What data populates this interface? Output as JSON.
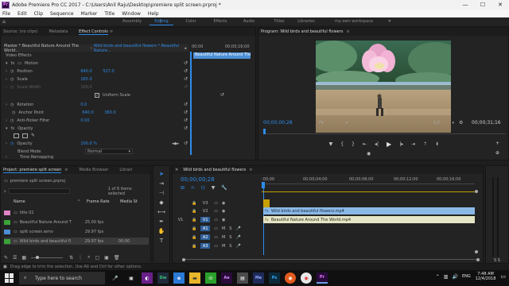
{
  "window": {
    "title": "Adobe Premiere Pro CC 2017 - C:\\Users\\Anil Raju\\Desktop\\premiere split screen.prproj *",
    "app_icon": "Pr",
    "min": "—",
    "max": "☐",
    "close": "✕"
  },
  "menu": [
    "File",
    "Edit",
    "Clip",
    "Sequence",
    "Marker",
    "Title",
    "Window",
    "Help"
  ],
  "workspaces": [
    "Assembly",
    "Editing",
    "Color",
    "Effects",
    "Audio",
    "Titles",
    "Libraries",
    "my own workspace"
  ],
  "workspace_active": "Editing",
  "effect_controls": {
    "tabs": [
      "Source: (no clips)",
      "Metadata",
      "Effect Controls"
    ],
    "active_tab": "Effect Controls",
    "master": "Master * Beautiful Nature Around The World...",
    "clip": "Wild birds and beautiful flowers * Beautiful Nature...",
    "tc_start": "00;00",
    "tc_end": "00;00;16;00",
    "timeline_clip": "Beautiful Nature Around The W",
    "video_effects": "Video Effects",
    "motion": "Motion",
    "position": {
      "label": "Position",
      "x": "640.0",
      "y": "527.0"
    },
    "scale": {
      "label": "Scale",
      "value": "165.0"
    },
    "scale_width": {
      "label": "Scale Width",
      "value": "100.0"
    },
    "uniform": {
      "label": "Uniform Scale",
      "checked": true
    },
    "rotation": {
      "label": "Rotation",
      "value": "0.0"
    },
    "anchor": {
      "label": "Anchor Point",
      "x": "640.0",
      "y": "360.0"
    },
    "antiflicker": {
      "label": "Anti-flicker Filter",
      "value": "0.00"
    },
    "opacity_group": "Opacity",
    "opacity": {
      "label": "Opacity",
      "value": "100.0 %"
    },
    "blend": {
      "label": "Blend Mode",
      "value": "Normal"
    },
    "time_remap": "Time Remapping"
  },
  "program": {
    "title": "Program: Wild birds and beautiful flowers",
    "menu_icon": "≡",
    "timecode": "00;00;00;28",
    "fit": "Fit",
    "fraction": "1/2",
    "duration": "00;00;31;16"
  },
  "project": {
    "tabs": [
      "Project: premiere split screen",
      "Media Browser",
      "Librari"
    ],
    "active_tab": "Project: premiere split screen",
    "file": "premiere split screen.prproj",
    "selected_info": "1 of 6 items selected",
    "columns": [
      "Name",
      "Frame Rate",
      "Media St"
    ],
    "items": [
      {
        "name": "title 02",
        "rate": "",
        "media": "",
        "color": "#e083c7"
      },
      {
        "name": "Beautiful Nature Around T",
        "rate": "25.00 fps",
        "media": "",
        "color": "#3aa33a"
      },
      {
        "name": "split screen.wmv",
        "rate": "29.97 fps",
        "media": "",
        "color": "#4c8fd6"
      },
      {
        "name": "Wild birds and beautiful fl",
        "rate": "29.97 fps",
        "media": "00;00",
        "color": "#3aa33a"
      }
    ]
  },
  "timeline": {
    "title": "Wild birds and beautiful flowers",
    "menu_icon": "≡",
    "timecode": "00;00;00;28",
    "ruler": [
      ":00;00",
      "00;00;04;00",
      "00;00;08;00",
      "00;00;12;00",
      "00;00;16;00"
    ],
    "tracks": {
      "v3": "V3",
      "v2": "V2",
      "v1": "V1",
      "a1": "A1",
      "a2": "A2",
      "a3": "A3",
      "v1src": "V1"
    },
    "clip_v2": "Wild birds and beautiful flowers.mp4",
    "clip_v1": "Beautiful Nature Around The World.mp4",
    "mute": "M",
    "solo": "S"
  },
  "status": "Drag edge to trim the selection. Use Alt and Ctrl for other options.",
  "taskbar": {
    "search_placeholder": "Type here to search",
    "time": "7:48 AM",
    "date": "12/4/2018",
    "lang": "ENG",
    "start_icon": "windows-logo"
  }
}
